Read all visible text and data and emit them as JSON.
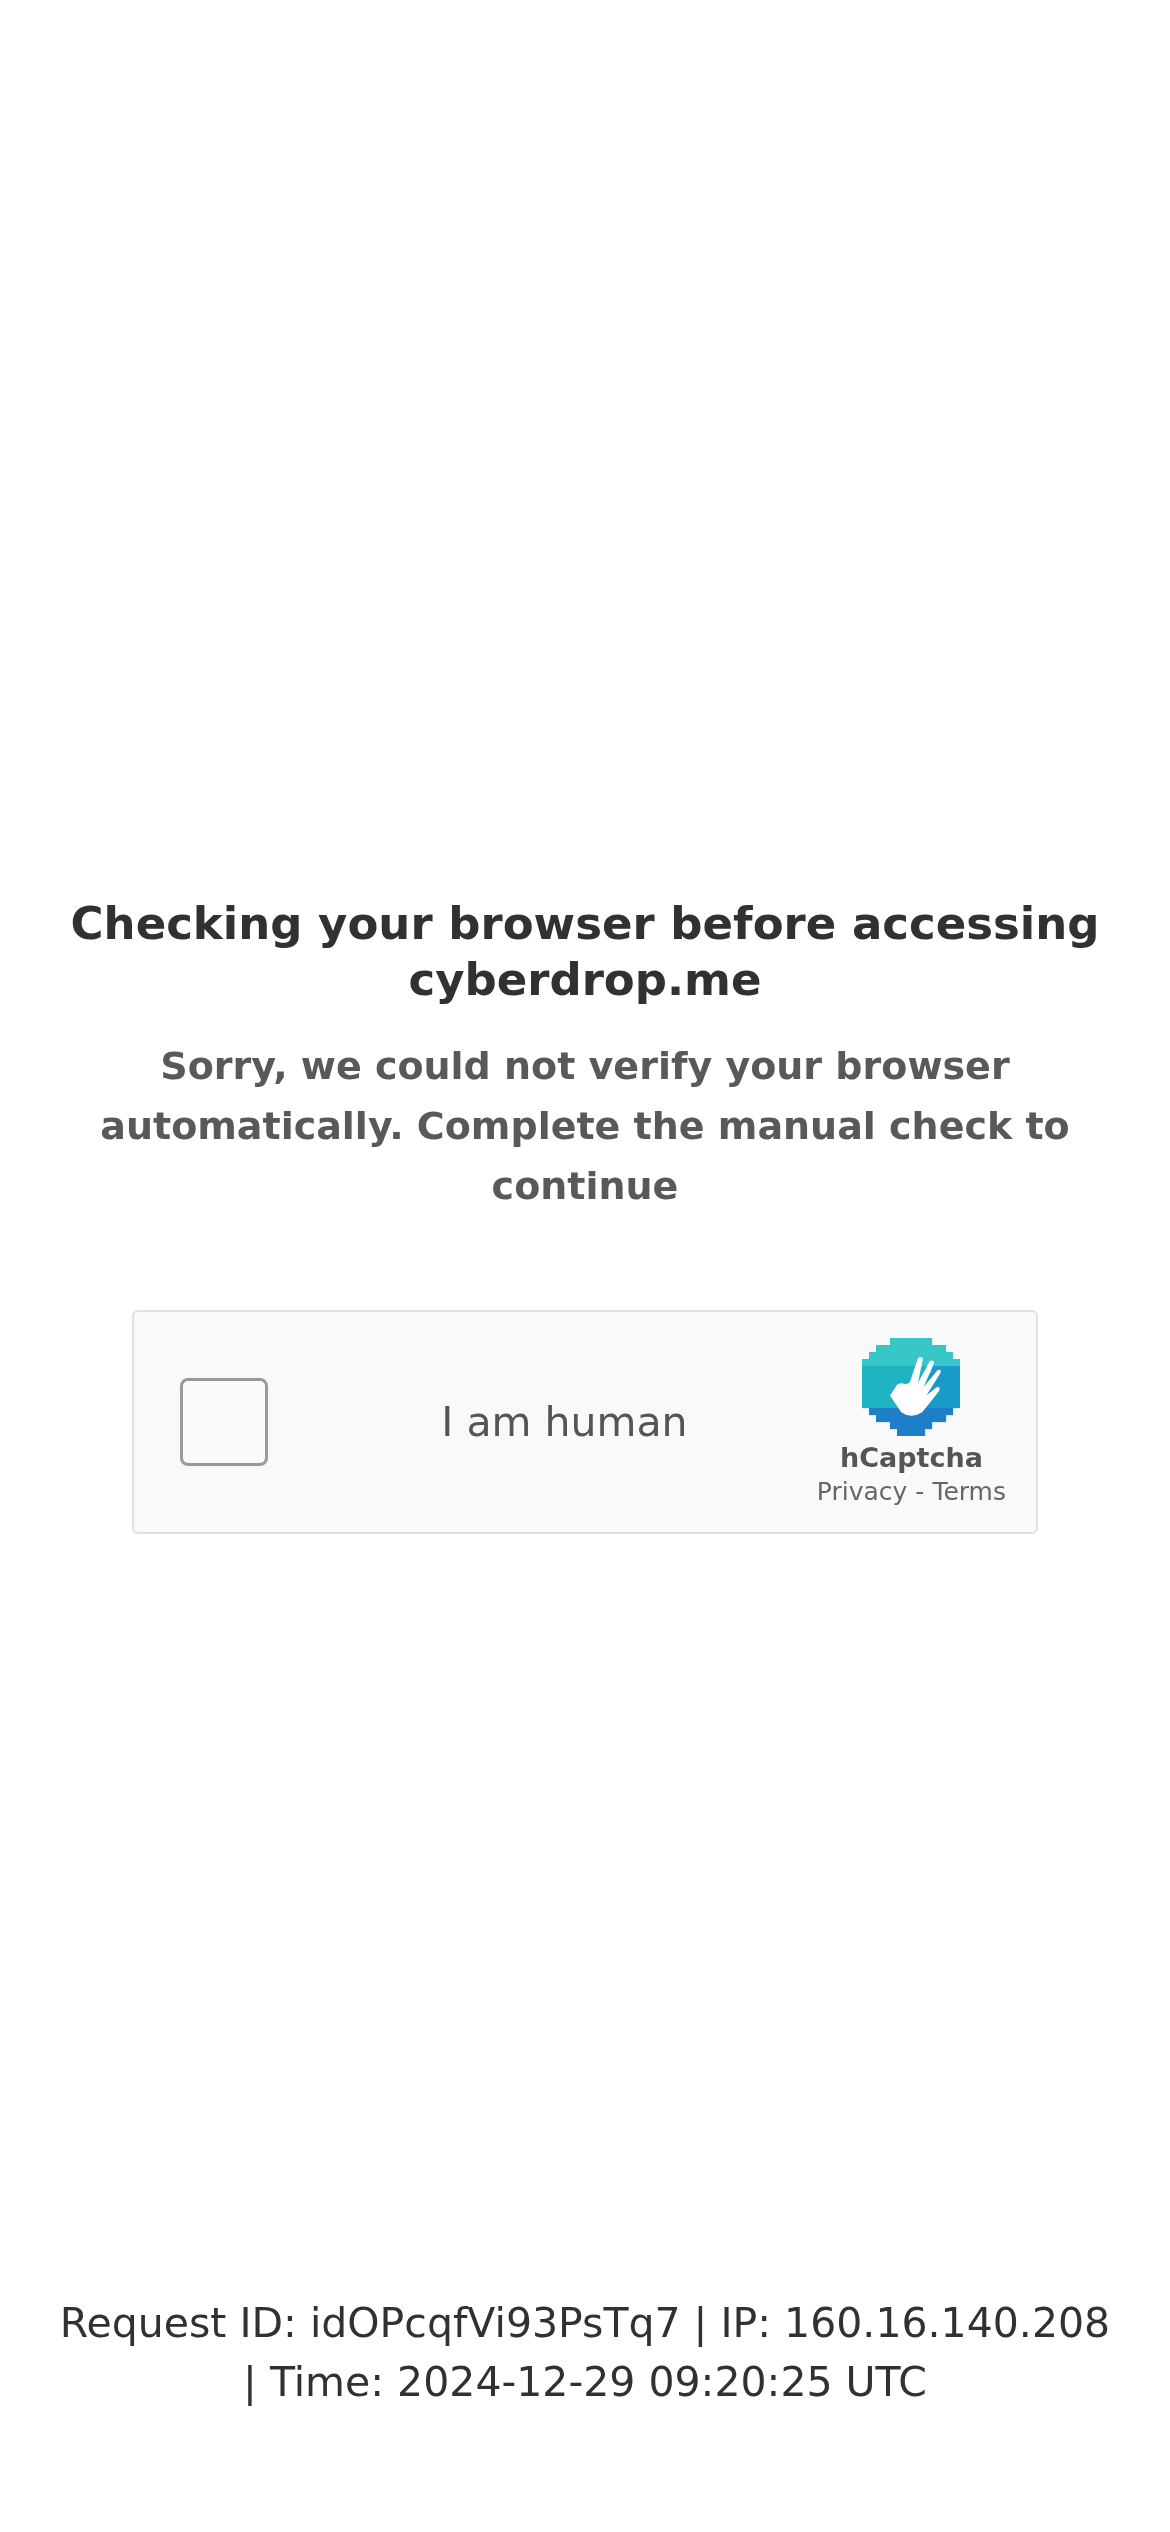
{
  "heading": "Checking your browser before accessing cyberdrop.me",
  "message": "Sorry, we could not verify your browser automatically. Complete the manual check to continue",
  "captcha": {
    "label": "I am human",
    "checked": false,
    "brand": "hCaptcha",
    "links": [
      "Privacy",
      "Terms"
    ],
    "separator": "-"
  },
  "footer": "Request ID: idOPcqfVi93PsTq7 | IP: 160.16.140.208 | Time: 2024-12-29 09:20:25 UTC"
}
